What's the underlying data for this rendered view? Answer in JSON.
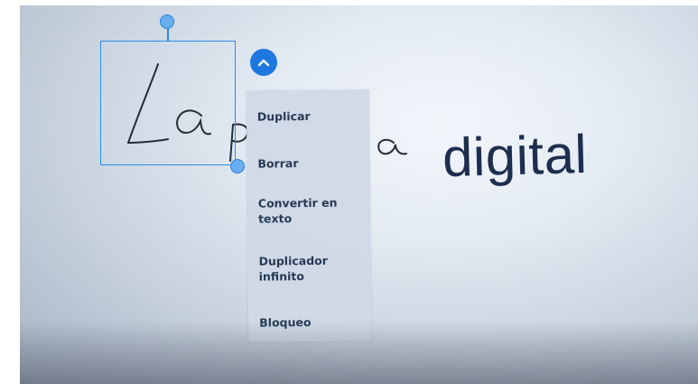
{
  "canvas": {
    "typed_text": "digital"
  },
  "selection": {
    "collapse_button_icon": "chevron-up-icon"
  },
  "context_menu": {
    "items": [
      {
        "label": "Duplicar"
      },
      {
        "label": "Borrar"
      },
      {
        "label": "Convertir en texto"
      },
      {
        "label": "Duplicador infinito"
      },
      {
        "label": "Bloqueo"
      }
    ]
  },
  "colors": {
    "accent": "#1f78e0",
    "selection_border": "#2d8be6",
    "text_dark": "#1e2e4f",
    "menu_bg": "#d0d8e5"
  }
}
